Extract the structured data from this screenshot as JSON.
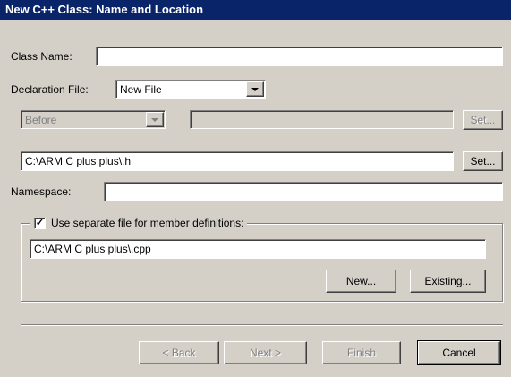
{
  "window": {
    "title": "New C++ Class: Name and Location"
  },
  "class_name": {
    "label": "Class Name:",
    "value": ""
  },
  "declaration": {
    "label": "Declaration File:",
    "selected": "New File"
  },
  "insert": {
    "position_selected": "Before",
    "target_value": "",
    "set_label": "Set..."
  },
  "header_file": {
    "value": "C:\\ARM C plus plus\\.h",
    "set_label": "Set..."
  },
  "namespace": {
    "label": "Namespace:",
    "value": ""
  },
  "member_defs": {
    "checkbox_label": "Use separate file for member definitions:",
    "checked": true,
    "path": "C:\\ARM C plus plus\\.cpp",
    "new_label": "New...",
    "existing_label": "Existing..."
  },
  "nav": {
    "back_label": "< Back",
    "next_label": "Next >",
    "finish_label": "Finish",
    "cancel_label": "Cancel"
  },
  "colors": {
    "titlebar": "#0a246a",
    "face": "#d4d0c8"
  }
}
